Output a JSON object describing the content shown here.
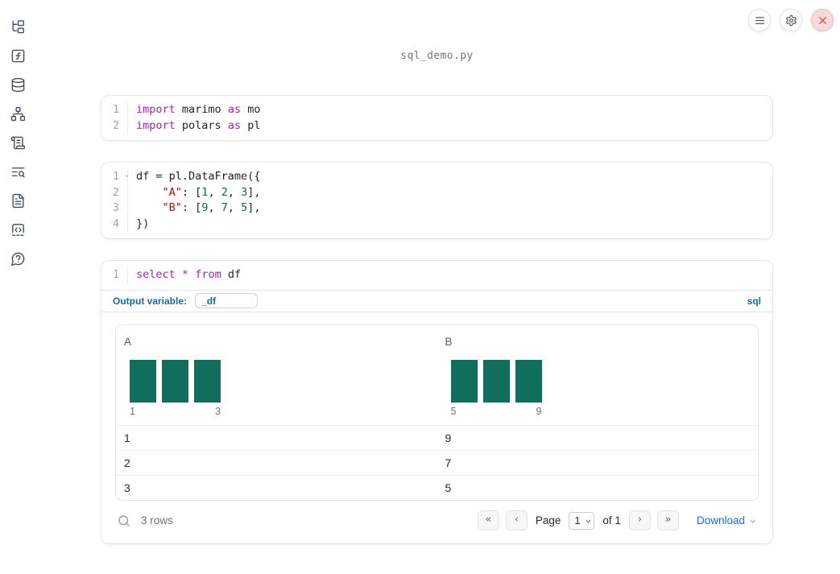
{
  "app": {
    "filename": "sql_demo.py"
  },
  "colors": {
    "accent_blue": "#1b6b9d",
    "link_blue": "#1a6fd1",
    "histogram_teal": "#116e5d",
    "keyword_purple": "#a626a4",
    "string_red": "#a31515",
    "number_green": "#11673f",
    "close_red": "#d25353"
  },
  "icons": {
    "menu": "hamburger",
    "settings": "gear",
    "close": "x",
    "fold": "⌄",
    "search": "magnifier",
    "download_caret": "chevron-down",
    "sidebar": [
      "file-tree",
      "function-square",
      "database",
      "dependency-graph",
      "scroll",
      "text-search",
      "document",
      "snippets",
      "help-bubble"
    ]
  },
  "cells": {
    "imports": {
      "lines": [
        {
          "num": "1",
          "t": [
            {
              "c": "kw",
              "v": "import"
            },
            {
              "c": "pl",
              "v": " marimo "
            },
            {
              "c": "kw",
              "v": "as"
            },
            {
              "c": "pl",
              "v": " mo"
            }
          ]
        },
        {
          "num": "2",
          "t": [
            {
              "c": "kw",
              "v": "import"
            },
            {
              "c": "pl",
              "v": " polars "
            },
            {
              "c": "kw",
              "v": "as"
            },
            {
              "c": "pl",
              "v": " pl"
            }
          ]
        }
      ]
    },
    "dataframe": {
      "lines": [
        {
          "num": "1",
          "t": [
            {
              "c": "pl",
              "v": "df = pl.DataFrame({"
            }
          ]
        },
        {
          "num": "2",
          "t": [
            {
              "c": "pl",
              "v": "    "
            },
            {
              "c": "str",
              "v": "\"A\""
            },
            {
              "c": "pl",
              "v": ": ["
            },
            {
              "c": "num",
              "v": "1"
            },
            {
              "c": "pl",
              "v": ", "
            },
            {
              "c": "num",
              "v": "2"
            },
            {
              "c": "pl",
              "v": ", "
            },
            {
              "c": "num",
              "v": "3"
            },
            {
              "c": "pl",
              "v": "],"
            }
          ]
        },
        {
          "num": "3",
          "t": [
            {
              "c": "pl",
              "v": "    "
            },
            {
              "c": "str",
              "v": "\"B\""
            },
            {
              "c": "pl",
              "v": ": ["
            },
            {
              "c": "num",
              "v": "9"
            },
            {
              "c": "pl",
              "v": ", "
            },
            {
              "c": "num",
              "v": "7"
            },
            {
              "c": "pl",
              "v": ", "
            },
            {
              "c": "num",
              "v": "5"
            },
            {
              "c": "pl",
              "v": "],"
            }
          ]
        },
        {
          "num": "4",
          "t": [
            {
              "c": "pl",
              "v": "})"
            }
          ]
        }
      ]
    },
    "sql": {
      "lines": [
        {
          "num": "1",
          "t": [
            {
              "c": "kw",
              "v": "select"
            },
            {
              "c": "pl",
              "v": " "
            },
            {
              "c": "kw",
              "v": "*"
            },
            {
              "c": "pl",
              "v": " "
            },
            {
              "c": "kw",
              "v": "from"
            },
            {
              "c": "pl",
              "v": " df"
            }
          ]
        }
      ],
      "output_variable_label": "Output variable:",
      "output_variable_value": "_df",
      "language": "sql"
    }
  },
  "table": {
    "columns": [
      {
        "label": "A",
        "hist": {
          "bar_values": [
            1,
            1,
            1
          ],
          "tick_min": "1",
          "tick_max": "3"
        }
      },
      {
        "label": "B",
        "hist": {
          "bar_values": [
            1,
            1,
            1
          ],
          "tick_min": "5",
          "tick_max": "9"
        }
      }
    ],
    "rows": [
      [
        "1",
        "9"
      ],
      [
        "2",
        "7"
      ],
      [
        "3",
        "5"
      ]
    ],
    "footer": {
      "row_count": "3 rows",
      "page_label": "Page",
      "page_value": "1",
      "of_label": "of 1",
      "first": "«",
      "prev": "‹",
      "next": "›",
      "last": "»",
      "download_label": "Download"
    }
  }
}
